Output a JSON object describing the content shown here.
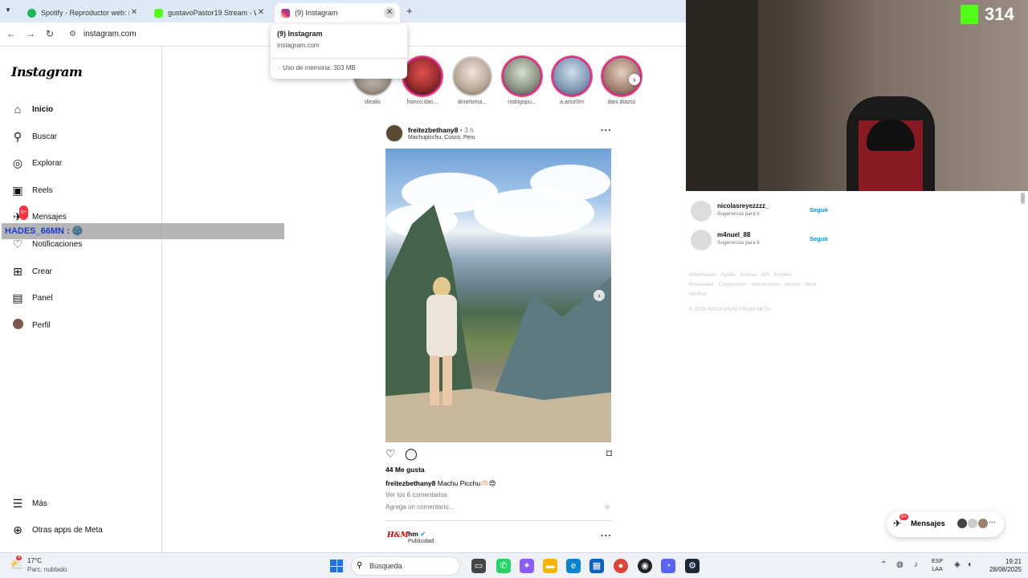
{
  "browser": {
    "tabs": [
      {
        "title": "Spotify - Reproductor web: mú",
        "favicon_color": "#1db954"
      },
      {
        "title": "gustavoPastor19 Stream - Wat",
        "favicon_color": "#53fc18"
      },
      {
        "title": "(9) Instagram",
        "favicon_color": "#d6249f"
      }
    ],
    "url": "instagram.com",
    "hover_card": {
      "title": "(9) Instagram",
      "domain": "instagram.com",
      "memory": "Uso de memoria: 303 MB"
    }
  },
  "instagram": {
    "logo": "Instagram",
    "nav": [
      {
        "label": "Inicio",
        "icon": "home-icon"
      },
      {
        "label": "Buscar",
        "icon": "search-icon"
      },
      {
        "label": "Explorar",
        "icon": "compass-icon"
      },
      {
        "label": "Reels",
        "icon": "reels-icon"
      },
      {
        "label": "Mensajes",
        "icon": "messenger-icon",
        "badge": "9+"
      },
      {
        "label": "Notificaciones",
        "icon": "heart-icon"
      },
      {
        "label": "Crear",
        "icon": "plus-icon"
      },
      {
        "label": "Panel",
        "icon": "chart-icon"
      },
      {
        "label": "Perfil",
        "icon": "avatar-icon"
      }
    ],
    "nav_bottom": [
      {
        "label": "Más",
        "icon": "menu-icon"
      },
      {
        "label": "Otras apps de Meta",
        "icon": "apps-icon"
      }
    ],
    "stories": [
      "diealis",
      "franco.dan...",
      "dimeloma...",
      "rodrigopu...",
      "a.artur0m",
      "dani.diazss"
    ],
    "post": {
      "username": "freitezbethany8",
      "time": "• 3 h",
      "location": "Machupicchu, Cusco, Peru",
      "likes": "44 Me gusta",
      "caption_user": "freitezbethany8",
      "caption_text": "Machu Picchu🫶🏻😍",
      "comments_link": "Ver los 6 comentarios",
      "add_comment": "Agrega un comentario..."
    },
    "post2": {
      "username": "hm",
      "sub": "Publicidad"
    },
    "suggestions": [
      {
        "name": "nicolasreyezzzz_",
        "sub": "Sugerencia para ti",
        "action": "Seguir"
      },
      {
        "name": "m4nuel_88",
        "sub": "Sugerencia para ti",
        "action": "Seguir"
      }
    ],
    "footer_links": "Información · Ayuda · Prensa · API · Empleo · Privacidad · Condiciones · Ubicaciones · Idioma · Meta Verified",
    "footer_copy": "© 2025 INSTAGRAM FROM META",
    "messages_pill": {
      "label": "Mensajes",
      "badge": "9+"
    }
  },
  "stream": {
    "chat_overlay": "HADES_66MN : 🌚",
    "viewer_count": "314"
  },
  "taskbar": {
    "weather_temp": "17°C",
    "weather_desc": "Parc. nublado",
    "weather_badge": "4",
    "search_placeholder": "Búsqueda",
    "lang_top": "ESP",
    "lang_bottom": "LAA",
    "time": "19:21",
    "date": "28/08/2025"
  }
}
